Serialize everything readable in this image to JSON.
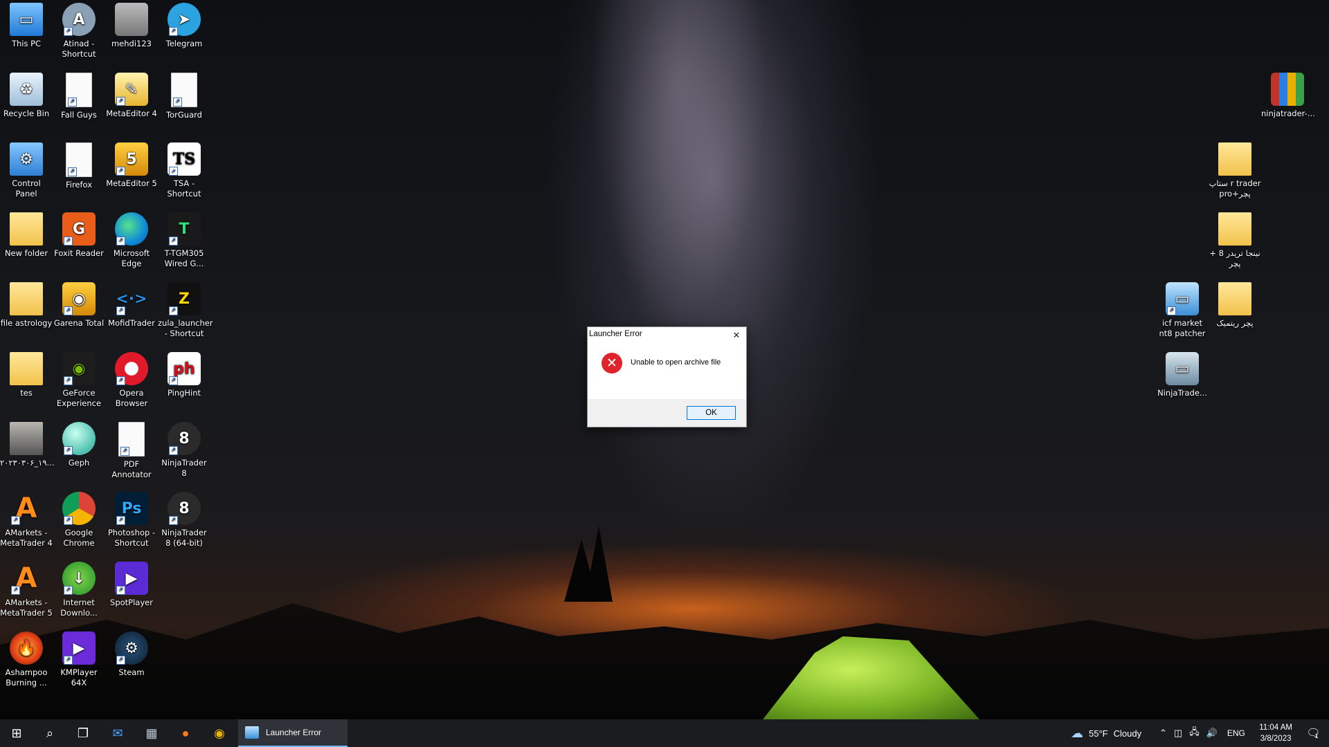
{
  "desktop": {
    "icons": [
      {
        "label": "This PC",
        "icon": "this-pc-icon"
      },
      {
        "label": "Atinad - Shortcut",
        "icon": "atinad-icon"
      },
      {
        "label": "mehdi123",
        "icon": "image-file-icon"
      },
      {
        "label": "Telegram",
        "icon": "telegram-icon"
      },
      {
        "label": "Recycle Bin",
        "icon": "recycle-bin-icon"
      },
      {
        "label": "Fall Guys",
        "icon": "file-icon"
      },
      {
        "label": "MetaEditor 4",
        "icon": "metaeditor-icon"
      },
      {
        "label": "TorGuard",
        "icon": "file-icon"
      },
      {
        "label": "Control Panel",
        "icon": "control-panel-icon"
      },
      {
        "label": "Firefox",
        "icon": "file-icon"
      },
      {
        "label": "MetaEditor 5",
        "icon": "metaeditor-5-icon"
      },
      {
        "label": "TSA - Shortcut",
        "icon": "tsa-icon"
      },
      {
        "label": "New folder",
        "icon": "folder-icon"
      },
      {
        "label": "Foxit Reader",
        "icon": "foxit-reader-icon"
      },
      {
        "label": "Microsoft Edge",
        "icon": "edge-icon"
      },
      {
        "label": "T-TGM305 Wired G...",
        "icon": "t-tgm305-icon"
      },
      {
        "label": "file astrology",
        "icon": "folder-icon"
      },
      {
        "label": "Garena Total",
        "icon": "garena-icon"
      },
      {
        "label": "MofidTrader",
        "icon": "mofidtrader-icon"
      },
      {
        "label": "zula_launcher - Shortcut",
        "icon": "zula-icon"
      },
      {
        "label": "tes",
        "icon": "folder-icon"
      },
      {
        "label": "GeForce Experience",
        "icon": "geforce-icon"
      },
      {
        "label": "Opera Browser",
        "icon": "opera-icon"
      },
      {
        "label": "PingHint",
        "icon": "pinghint-icon"
      },
      {
        "label": "۲۰۲۳۰۳۰۶_۱۹...",
        "icon": "photo-icon"
      },
      {
        "label": "Geph",
        "icon": "geph-icon"
      },
      {
        "label": "PDF Annotator",
        "icon": "pdf-annotator-icon"
      },
      {
        "label": "NinjaTrader 8",
        "icon": "ninjatrader-icon"
      },
      {
        "label": "AMarkets - MetaTrader 4",
        "icon": "amarkets-icon"
      },
      {
        "label": "Google Chrome",
        "icon": "chrome-icon"
      },
      {
        "label": "Photoshop - Shortcut",
        "icon": "photoshop-icon"
      },
      {
        "label": "NinjaTrader 8 (64-bit)",
        "icon": "ninjatrader-icon"
      },
      {
        "label": "AMarkets - MetaTrader 5",
        "icon": "amarkets-icon"
      },
      {
        "label": "Internet Downlo...",
        "icon": "idm-icon"
      },
      {
        "label": "SpotPlayer",
        "icon": "spotplayer-icon"
      },
      {
        "label": "Ashampoo Burning ...",
        "icon": "ashampoo-icon"
      },
      {
        "label": "KMPlayer 64X",
        "icon": "kmplayer-icon"
      },
      {
        "label": "Steam",
        "icon": "steam-icon"
      },
      {
        "label": "ninjatrader-...",
        "icon": "winrar-icon"
      },
      {
        "label": "ستاپ r trader pro+پچر",
        "icon": "folder-icon"
      },
      {
        "label": "نینجا تریدر 8 + پچر",
        "icon": "folder-icon"
      },
      {
        "label": "icf market nt8 patcher",
        "icon": "setup-icon"
      },
      {
        "label": "پچر ریتمیک",
        "icon": "folder-icon"
      },
      {
        "label": "NinjaTrade...",
        "icon": "ninjatrader-setup-icon"
      }
    ]
  },
  "dialog": {
    "title": "Launcher Error",
    "message": "Unable to open archive file",
    "ok_label": "OK",
    "icon": "error-icon"
  },
  "taskbar": {
    "active_window_label": "Launcher Error",
    "weather": {
      "temp": "55°F",
      "condition": "Cloudy"
    },
    "language": "ENG",
    "time": "11:04 AM",
    "date": "3/8/2023",
    "notification_count": "1"
  },
  "colors": {
    "accent": "#0078d7",
    "error": "#e0242b",
    "taskbar": "#1a1c20"
  }
}
